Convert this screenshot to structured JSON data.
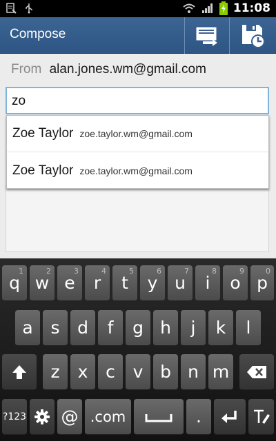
{
  "status_bar": {
    "time": "11:08",
    "icons": [
      "notepad-icon",
      "usb-icon",
      "wifi-icon",
      "signal-icon",
      "battery-charging-icon"
    ]
  },
  "action_bar": {
    "title": "Compose",
    "send_button": "send-icon",
    "save_button": "save-draft-icon"
  },
  "compose": {
    "from_label": "From",
    "from_value": "alan.jones.wm@gmail.com",
    "to_value": "zo"
  },
  "suggestions": [
    {
      "name": "Zoe Taylor",
      "email": "zoe.taylor.wm@gmail.com"
    },
    {
      "name": "Zoe Taylor",
      "email": "zoe.taylor.wm@gmail.com"
    }
  ],
  "keyboard": {
    "row1": [
      {
        "key": "q",
        "hint": "1"
      },
      {
        "key": "w",
        "hint": "2"
      },
      {
        "key": "e",
        "hint": "3"
      },
      {
        "key": "r",
        "hint": "4"
      },
      {
        "key": "t",
        "hint": "5"
      },
      {
        "key": "y",
        "hint": "6"
      },
      {
        "key": "u",
        "hint": "7"
      },
      {
        "key": "i",
        "hint": "8"
      },
      {
        "key": "o",
        "hint": "9"
      },
      {
        "key": "p",
        "hint": "0"
      }
    ],
    "row2": [
      "a",
      "s",
      "d",
      "f",
      "g",
      "h",
      "j",
      "k",
      "l"
    ],
    "row3": [
      "z",
      "x",
      "c",
      "v",
      "b",
      "n",
      "m"
    ],
    "sym_key": "?123",
    "at_key": "@",
    "com_key": ".com",
    "period_key": ".",
    "icons": {
      "shift": "shift-icon",
      "backspace": "backspace-icon",
      "settings": "settings-gear-icon",
      "space": "space-icon",
      "enter": "enter-icon",
      "text_input": "text-input-icon"
    }
  }
}
